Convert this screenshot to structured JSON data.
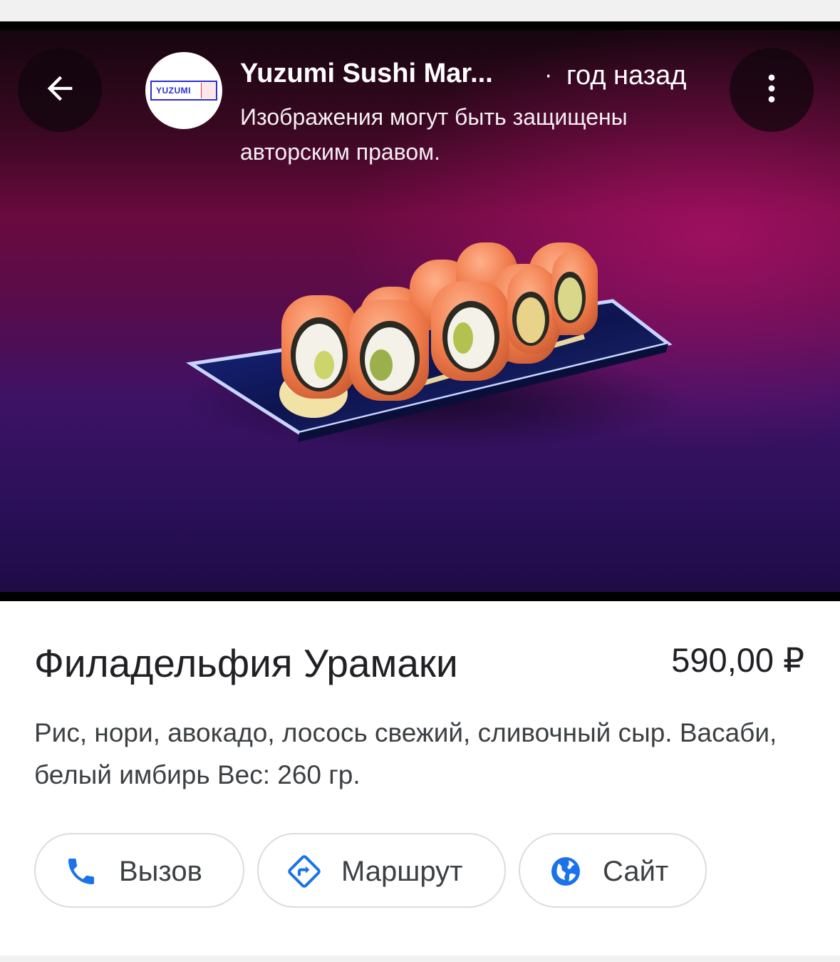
{
  "header": {
    "store_name": "Yuzumi Sushi Mar...",
    "separator": "·",
    "time_ago": "год назад",
    "copyright_notice": "Изображения могут быть защищены авторским правом.",
    "logo_text": "YUZUMI"
  },
  "item": {
    "title": "Филадельфия Урамаки",
    "price": "590,00 ₽",
    "description": "Рис, нори, авокадо, лосось свежий, сливочный сыр. Васаби, белый имбирь Вес: 260 гр."
  },
  "actions": {
    "call_label": "Вызов",
    "route_label": "Маршрут",
    "site_label": "Сайт"
  },
  "icons": {
    "back": "arrow-left-icon",
    "more": "more-vert-icon",
    "call": "phone-icon",
    "route": "directions-icon",
    "site": "globe-icon"
  },
  "colors": {
    "accent_blue": "#1a73e8",
    "text_primary": "#202124",
    "text_secondary": "#3c4043",
    "button_border": "#dadce0"
  }
}
